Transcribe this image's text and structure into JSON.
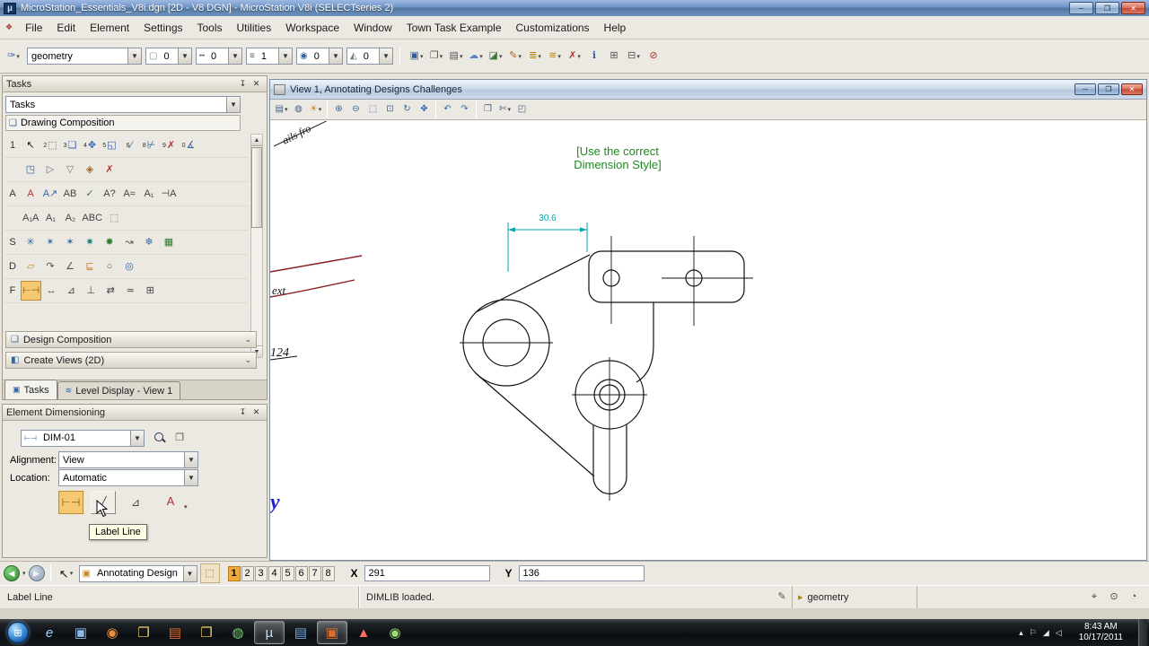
{
  "titlebar": {
    "app_glyph": "µ",
    "title": "MicroStation_Essentials_V8i.dgn [2D - V8 DGN] - MicroStation V8i (SELECTseries 2)",
    "buttons": {
      "minimize": "─",
      "maximize": "❐",
      "close": "✕"
    }
  },
  "menubar": {
    "marker_glyph": "❖",
    "items": [
      "File",
      "Edit",
      "Element",
      "Settings",
      "Tools",
      "Utilities",
      "Workspace",
      "Window",
      "Town Task Example",
      "Customizations",
      "Help"
    ]
  },
  "toolbar": {
    "attributes_button": {
      "n": "active-element-template",
      "g": "✑",
      "c": "#3465a4"
    },
    "level_value": "geometry",
    "attr_combos": [
      {
        "n": "active-color",
        "g": "▢",
        "c": "#888888",
        "v": "0"
      },
      {
        "n": "active-line-style",
        "g": "╍",
        "c": "#555555",
        "v": "0"
      },
      {
        "n": "active-line-weight",
        "g": "≡",
        "c": "#555555",
        "v": "1"
      },
      {
        "n": "active-template",
        "g": "◉",
        "c": "#3465a4",
        "v": "0"
      },
      {
        "n": "active-transparency",
        "g": "◭",
        "c": "#777777",
        "v": "0"
      }
    ],
    "primary_icons": [
      {
        "n": "models",
        "g": "▣",
        "c": "#2e5fa3",
        "dd": 1
      },
      {
        "n": "references",
        "g": "❐",
        "c": "#555555",
        "dd": 1
      },
      {
        "n": "raster-manager",
        "g": "▤",
        "c": "#555555",
        "dd": 1
      },
      {
        "n": "point-clouds",
        "g": "☁",
        "c": "#5b84c4",
        "dd": 1
      },
      {
        "n": "saved-views",
        "g": "◪",
        "c": "#3f7a3f",
        "dd": 1
      },
      {
        "n": "markups",
        "g": "✎",
        "c": "#b05a2a",
        "dd": 1
      },
      {
        "n": "level-manager",
        "g": "≣",
        "c": "#b8860b",
        "dd": 1
      },
      {
        "n": "level-display",
        "g": "≋",
        "c": "#b8860b",
        "dd": 1
      },
      {
        "n": "project-explorer",
        "g": "✗",
        "c": "#b03030",
        "dd": 1
      },
      {
        "n": "element-information",
        "g": "ℹ",
        "c": "#2e5fa3",
        "dd": 0
      },
      {
        "n": "toggle-accudraw",
        "g": "⊞",
        "c": "#555555",
        "dd": 0
      },
      {
        "n": "key-in",
        "g": "⊟",
        "c": "#555555",
        "dd": 1
      },
      {
        "n": "cancel",
        "g": "⊘",
        "c": "#b03030",
        "dd": 0
      }
    ]
  },
  "tasks_panel": {
    "title": "Tasks",
    "pin_glyph": "↧",
    "close_glyph": "✕",
    "combo_value": "Tasks",
    "drawing_composition": "Drawing Composition",
    "drawing_composition_icon": "❑",
    "tool_rows": [
      {
        "label": "1",
        "icons": [
          {
            "n": "element-selection",
            "g": "↖",
            "c": "#111111"
          },
          {
            "n": "fence",
            "g": "⬚",
            "c": "#555555",
            "b": "2"
          },
          {
            "n": "copy-element",
            "g": "❏",
            "c": "#3465a4",
            "b": "3"
          },
          {
            "n": "move-element",
            "g": "✥",
            "c": "#3465a4",
            "b": "4"
          },
          {
            "n": "modify-element",
            "g": "◱",
            "c": "#3465a4",
            "b": "5"
          },
          {
            "n": "trim-element",
            "g": "∕",
            "c": "#3465a4",
            "b": "6"
          },
          {
            "n": "extend-element",
            "g": "⊬",
            "c": "#3465a4",
            "b": "8"
          },
          {
            "n": "delete-element",
            "g": "✗",
            "c": "#c03030",
            "b": "9"
          },
          {
            "n": "measure-angle",
            "g": "∡",
            "c": "#3465a4",
            "b": "0"
          }
        ]
      },
      {
        "label": "",
        "icons": [
          {
            "n": "place-annotation",
            "g": "◳",
            "c": "#3465a4"
          },
          {
            "n": "place-callout",
            "g": "▷",
            "c": "#777777"
          },
          {
            "n": "place-terminator",
            "g": "▽",
            "c": "#777777"
          },
          {
            "n": "annotation-scale",
            "g": "◈",
            "c": "#9a6a2a"
          },
          {
            "n": "delete-annotation",
            "g": "✗",
            "c": "#c03030"
          }
        ]
      },
      {
        "label": "A",
        "icons": [
          {
            "n": "place-text",
            "g": "A",
            "c": "#b03030"
          },
          {
            "n": "place-note",
            "g": "A↗",
            "c": "#3465a4"
          },
          {
            "n": "edit-text",
            "g": "AB",
            "c": "#444444"
          },
          {
            "n": "spell-checker",
            "g": "✓",
            "c": "#2e7d32"
          },
          {
            "n": "display-text-attributes",
            "g": "A?",
            "c": "#444444"
          },
          {
            "n": "match-text-attributes",
            "g": "A≈",
            "c": "#444444"
          },
          {
            "n": "change-text-attributes",
            "g": "A₁",
            "c": "#444444"
          },
          {
            "n": "copy-increment-text",
            "g": "⊣A",
            "c": "#444444"
          }
        ]
      },
      {
        "label": "",
        "icons": [
          {
            "n": "text-styles",
            "g": "A₁A",
            "c": "#444444"
          },
          {
            "n": "place-data-field",
            "g": "A₁",
            "c": "#444444"
          },
          {
            "n": "copy-enter-data-field",
            "g": "A₂",
            "c": "#444444"
          },
          {
            "n": "fill-data-fields",
            "g": "ABC",
            "c": "#444444"
          },
          {
            "n": "auto-fill-data-fields",
            "g": "⬚",
            "c": "#777777"
          }
        ]
      },
      {
        "label": "S",
        "icons": [
          {
            "n": "hatch-area",
            "g": "✳",
            "c": "#3465a4"
          },
          {
            "n": "crosshatch-area",
            "g": "✴",
            "c": "#3465a4"
          },
          {
            "n": "pattern-area",
            "g": "✶",
            "c": "#3465a4"
          },
          {
            "n": "linear-pattern",
            "g": "✷",
            "c": "#17807e"
          },
          {
            "n": "show-pattern-attributes",
            "g": "✸",
            "c": "#2e7d32"
          },
          {
            "n": "match-pattern-attributes",
            "g": "↝",
            "c": "#555555"
          },
          {
            "n": "delete-pattern",
            "g": "❄",
            "c": "#3465a4"
          },
          {
            "n": "pattern-settings",
            "g": "▦",
            "c": "#2e7d32"
          }
        ]
      },
      {
        "label": "D",
        "icons": [
          {
            "n": "place-fitted-section",
            "g": "▱",
            "c": "#c8882a"
          },
          {
            "n": "attach-folded-view",
            "g": "↷",
            "c": "#555555"
          },
          {
            "n": "section-angle",
            "g": "∠",
            "c": "#555555"
          },
          {
            "n": "clip-view",
            "g": "⊑",
            "c": "#c8882a"
          },
          {
            "n": "modify-clip",
            "g": "○",
            "c": "#555555"
          },
          {
            "n": "detail-view",
            "g": "◎",
            "c": "#3465a4"
          }
        ]
      },
      {
        "label": "F",
        "icons": [
          {
            "n": "dimension-element",
            "g": "⊢⊣",
            "c": "#7a5a10",
            "active": 1
          },
          {
            "n": "dimension-linear",
            "g": "↔",
            "c": "#444444"
          },
          {
            "n": "dimension-angular",
            "g": "⊿",
            "c": "#444444"
          },
          {
            "n": "dimension-ordinate",
            "g": "⊥",
            "c": "#444444"
          },
          {
            "n": "change-dimension",
            "g": "⇄",
            "c": "#444444"
          },
          {
            "n": "match-dimension",
            "g": "≃",
            "c": "#444444"
          },
          {
            "n": "dimension-settings",
            "g": "⊞",
            "c": "#444444"
          }
        ]
      }
    ],
    "sections": [
      {
        "label": "Design Composition",
        "icon": "❑"
      },
      {
        "label": "Create Views (2D)",
        "icon": "◧"
      }
    ],
    "tabs": [
      {
        "label": "Tasks",
        "icon": "▣"
      },
      {
        "label": "Level Display - View 1",
        "icon": "≋"
      }
    ]
  },
  "element_dimensioning": {
    "title": "Element Dimensioning",
    "pin_glyph": "↧",
    "close_glyph": "✕",
    "style_icon": "⊢⊣",
    "style_value": "DIM-01",
    "alignment_label": "Alignment:",
    "alignment_value": "View",
    "location_label": "Location:",
    "location_value": "Automatic",
    "buttons": [
      {
        "n": "dimension-element",
        "g": "⊢⊣",
        "c": "#7a5a10",
        "active": 1
      },
      {
        "n": "label-line",
        "g": "╱",
        "c": "#444444",
        "hover": 1
      },
      {
        "n": "dimension-angle-between-lines",
        "g": "⊿",
        "c": "#444444"
      }
    ],
    "annotation_icon": {
      "n": "annotate-element",
      "g": "A",
      "c": "#b03030"
    },
    "tooltip": "Label Line"
  },
  "view_window": {
    "title": "View 1, Annotating Designs Challenges",
    "buttons": {
      "minimize": "─",
      "maximize": "❐",
      "close": "✕"
    },
    "toolbar_icons": [
      {
        "n": "view-attributes",
        "g": "▤",
        "c": "#44608a",
        "dd": 1
      },
      {
        "n": "display-style",
        "g": "◍",
        "c": "#44608a"
      },
      {
        "n": "adjust-brightness",
        "g": "☀",
        "c": "#c8882a",
        "dd": 1
      },
      {
        "sep": 1
      },
      {
        "n": "zoom-in",
        "g": "⊕",
        "c": "#3465a4"
      },
      {
        "n": "zoom-out",
        "g": "⊖",
        "c": "#3465a4"
      },
      {
        "n": "window-area",
        "g": "⬚",
        "c": "#3465a4"
      },
      {
        "n": "fit-view",
        "g": "⊡",
        "c": "#3465a4"
      },
      {
        "n": "rotate-view",
        "g": "↻",
        "c": "#3465a4"
      },
      {
        "n": "pan-view",
        "g": "✥",
        "c": "#3465a4"
      },
      {
        "sep": 1
      },
      {
        "n": "view-previous",
        "g": "↶",
        "c": "#3465a4"
      },
      {
        "n": "view-next",
        "g": "↷",
        "c": "#3465a4"
      },
      {
        "sep": 1
      },
      {
        "n": "copy-view",
        "g": "❐",
        "c": "#44608a"
      },
      {
        "n": "clip-volume",
        "g": "✄",
        "c": "#44608a",
        "dd": 1
      },
      {
        "n": "clip-mask",
        "g": "◰",
        "c": "#44608a"
      }
    ],
    "note_line1": "[Use the correct",
    "note_line2": "Dimension Style]",
    "dimension_value": "30.6",
    "texts": {
      "corner": "ails fro",
      "ext": "ext",
      "num": "124",
      "y": "y"
    },
    "colors": {
      "note": "#1e8a1e",
      "dimension": "#00a8a8",
      "geometry": "#111111",
      "red_curves": "#8b1f1f",
      "blue_text": "#2222cc"
    }
  },
  "bottom_bar": {
    "back_glyph": "◀",
    "forward_glyph": "▶",
    "pointer_glyph": "↖",
    "task_combo_icon": "▣",
    "task_combo_value": "Annotating Design",
    "fence_icon": "⬚",
    "view_toggles": [
      "1",
      "2",
      "3",
      "4",
      "5",
      "6",
      "7",
      "8"
    ],
    "active_view": "1",
    "x_label": "X",
    "x_value": "291",
    "y_label": "Y",
    "y_value": "136"
  },
  "status_bar": {
    "tool": "Label Line",
    "message": "DIMLIB loaded.",
    "pen_icon": "✎",
    "level_icon": "▸",
    "active_level": "geometry",
    "right_icons": [
      {
        "n": "snap-mode",
        "g": "⌖",
        "c": "#444444"
      },
      {
        "n": "locks",
        "g": "⊙",
        "c": "#444444"
      },
      {
        "n": "design-history",
        "g": "◔",
        "c": "#444444"
      }
    ]
  },
  "taskbar": {
    "start_glyph": "⊞",
    "items": [
      {
        "n": "internet-explorer",
        "g": "e",
        "c": "#9fd2ff",
        "it": 1
      },
      {
        "n": "computer",
        "g": "▣",
        "c": "#8fb8e8"
      },
      {
        "n": "media-player",
        "g": "◉",
        "c": "#e8913d"
      },
      {
        "n": "libraries",
        "g": "❐",
        "c": "#f3cf63"
      },
      {
        "n": "powerpoint",
        "g": "▤",
        "c": "#e06c2b"
      },
      {
        "n": "documents",
        "g": "❐",
        "c": "#f3cf63"
      },
      {
        "n": "network-places",
        "g": "◍",
        "c": "#7fc87f"
      },
      {
        "n": "microstation",
        "g": "µ",
        "c": "#bfe0ff",
        "active": 1
      },
      {
        "n": "word",
        "g": "▤",
        "c": "#6fa8dc"
      },
      {
        "n": "powerpoint-show",
        "g": "▣",
        "c": "#e06c2b",
        "active": 1
      },
      {
        "n": "adobe-reader",
        "g": "▲",
        "c": "#ff6b5e"
      },
      {
        "n": "screen-capture",
        "g": "◉",
        "c": "#9fdf6f"
      }
    ],
    "tray": [
      {
        "n": "show-hidden-icons",
        "g": "▴",
        "c": "#e8e8e8"
      },
      {
        "n": "action-center",
        "g": "⚐",
        "c": "#e8e8e8"
      },
      {
        "n": "network-status",
        "g": "◢",
        "c": "#e8e8e8"
      },
      {
        "n": "volume",
        "g": "◁",
        "c": "#e8e8e8"
      }
    ],
    "time": "8:43 AM",
    "date": "10/17/2011"
  }
}
